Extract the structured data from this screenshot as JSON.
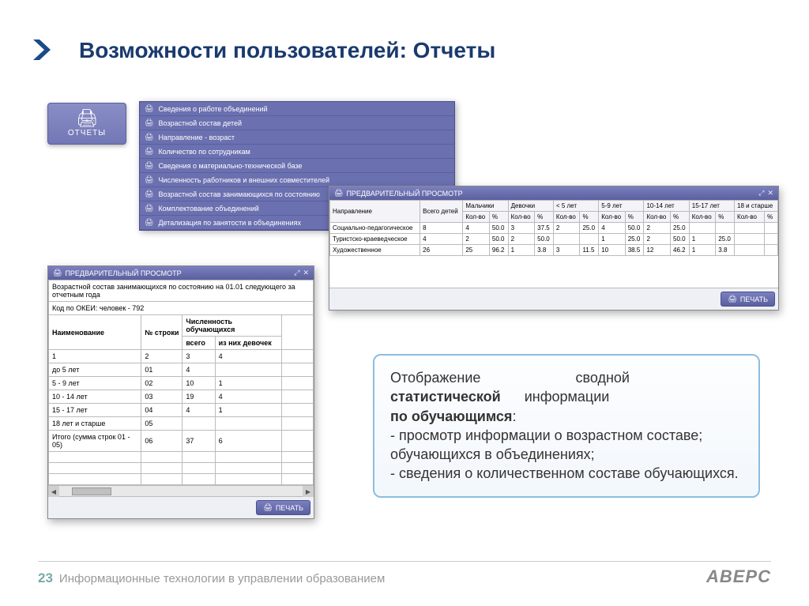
{
  "title": "Возможности пользователей: Отчеты",
  "reports_btn": {
    "label": "ОТЧЕТЫ"
  },
  "menu": {
    "items": [
      "Сведения о работе объединений",
      "Возрастной состав детей",
      "Направление - возраст",
      "Количество по сотрудникам",
      "Сведения о материально-технической базе",
      "Численность работников и внешних совместителей",
      "Возрастной состав занимающихся по состоянию",
      "Комплектование объединений",
      "Детализация по занятости в объединениях"
    ]
  },
  "preview_title": "ПРЕДВАРИТЕЛЬНЫЙ ПРОСМОТР",
  "print_label": "ПЕЧАТЬ",
  "p2": {
    "col_main1": "Направление",
    "col_main2": "Всего детей",
    "groups": [
      "Мальчики",
      "Девочки",
      "< 5 лет",
      "5-9 лет",
      "10-14 лет",
      "15-17 лет",
      "18 и старше"
    ],
    "sub1": "Кол-во",
    "sub2": "%",
    "rows": [
      {
        "name": "Социально-педагогическое",
        "total": "8",
        "cells": [
          "4",
          "50.0",
          "3",
          "37.5",
          "2",
          "25.0",
          "4",
          "50.0",
          "2",
          "25.0",
          "",
          "",
          "",
          ""
        ]
      },
      {
        "name": "Туристско-краеведческое",
        "total": "4",
        "cells": [
          "2",
          "50.0",
          "2",
          "50.0",
          "",
          "",
          "1",
          "25.0",
          "2",
          "50.0",
          "1",
          "25.0",
          "",
          ""
        ]
      },
      {
        "name": "Художественное",
        "total": "26",
        "cells": [
          "25",
          "96.2",
          "1",
          "3.8",
          "3",
          "11.5",
          "10",
          "38.5",
          "12",
          "46.2",
          "1",
          "3.8",
          "",
          ""
        ]
      }
    ]
  },
  "p1": {
    "header_text": "Возрастной состав занимающихся по состоянию на 01.01 следующего за отчетным года",
    "okei": "Код по ОКЕИ: человек - 792",
    "col_name": "Наименование",
    "col_row": "№ строки",
    "col_count": "Численность обучающихся",
    "col_total": "всего",
    "col_girls": "из них девочек",
    "idx_row": [
      "1",
      "2",
      "3",
      "4"
    ],
    "rows": [
      {
        "name": "до 5 лет",
        "n": "01",
        "t": "4",
        "g": ""
      },
      {
        "name": "5 - 9 лет",
        "n": "02",
        "t": "10",
        "g": "1"
      },
      {
        "name": "10 - 14 лет",
        "n": "03",
        "t": "19",
        "g": "4"
      },
      {
        "name": "15 - 17 лет",
        "n": "04",
        "t": "4",
        "g": "1"
      },
      {
        "name": "18 лет и старше",
        "n": "05",
        "t": "",
        "g": ""
      },
      {
        "name": "Итого (сумма строк 01 - 05)",
        "n": "06",
        "t": "37",
        "g": "6"
      }
    ]
  },
  "info": {
    "l1a": "Отображение",
    "l1b": "сводной",
    "l2a": "статистической",
    "l2b": "информации",
    "l3": "по обучающимся",
    "colon": ":",
    "b1": "- просмотр информации о возрастном составе; обучающихся в объединениях;",
    "b2": "- сведения о количественном составе обучающихся."
  },
  "footer": {
    "num": "23",
    "text": "Информационные технологии в управлении образованием",
    "brand": "АВЕРС"
  }
}
